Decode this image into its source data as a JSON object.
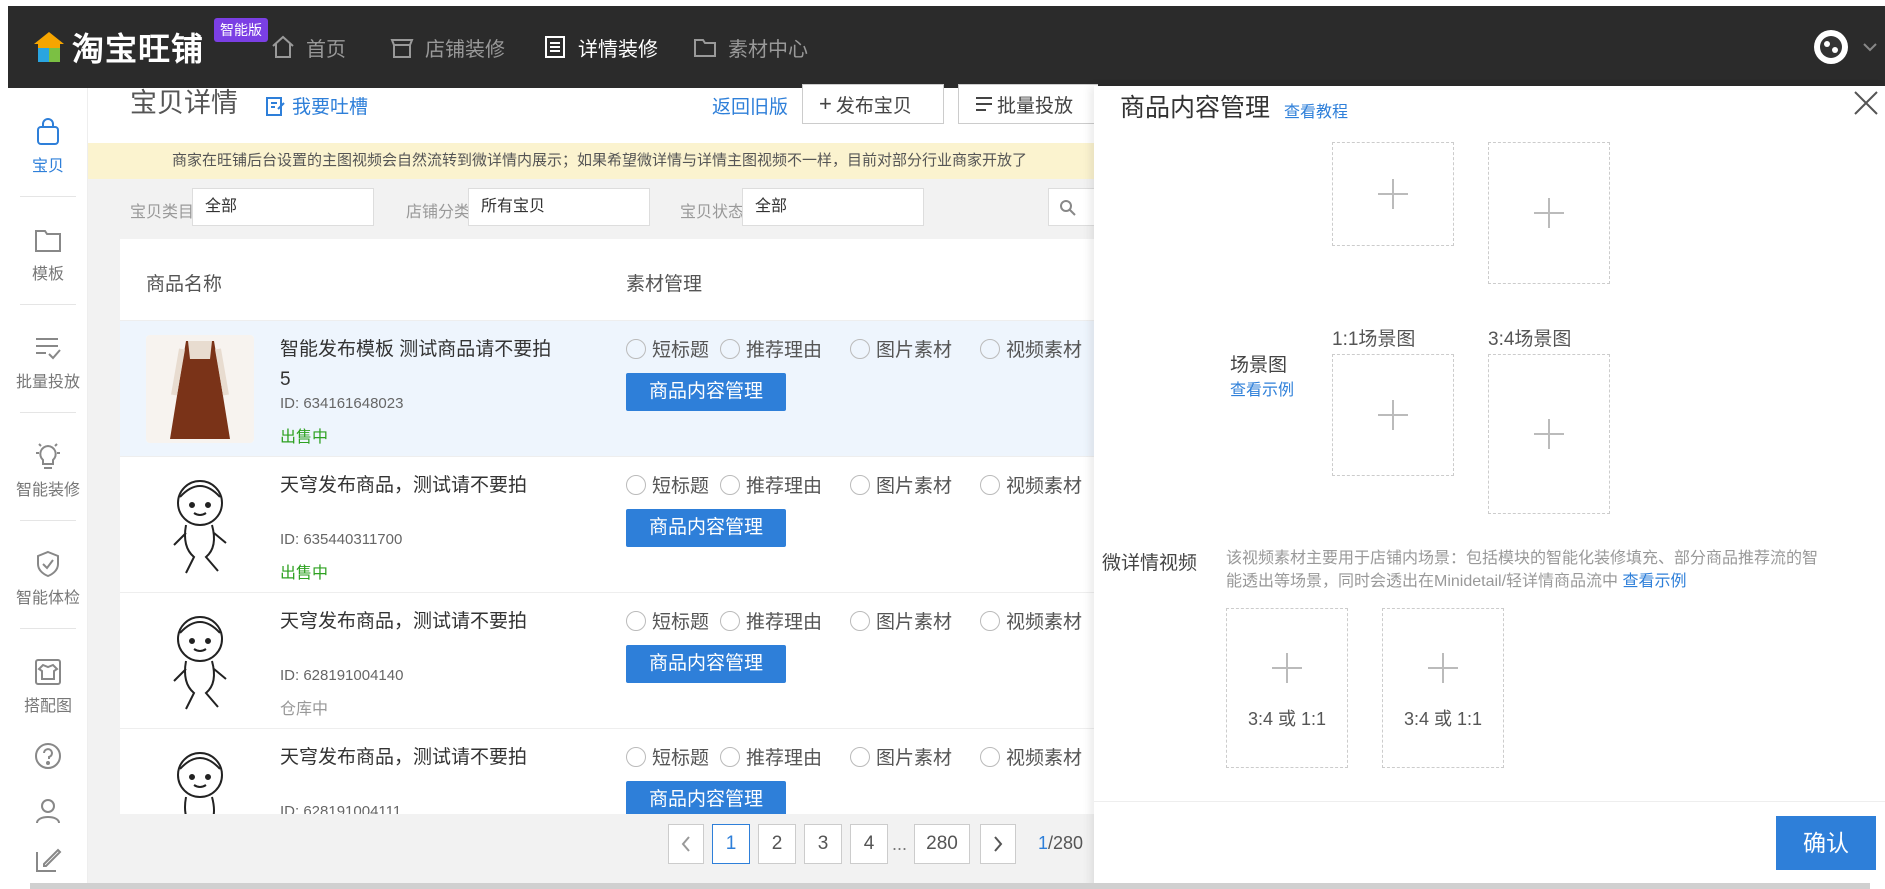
{
  "topbar": {
    "logo_text": "淘宝旺铺",
    "badge": "智能版",
    "nav": [
      {
        "label": "首页",
        "icon": "home-icon"
      },
      {
        "label": "店铺装修",
        "icon": "store-icon"
      },
      {
        "label": "详情装修",
        "icon": "document-icon"
      },
      {
        "label": "素材中心",
        "icon": "folder-icon"
      }
    ]
  },
  "sidebar": {
    "items": [
      {
        "label": "宝贝",
        "icon": "bag-icon"
      },
      {
        "label": "模板",
        "icon": "template-icon"
      },
      {
        "label": "批量投放",
        "icon": "batch-icon"
      },
      {
        "label": "智能装修",
        "icon": "bulb-icon"
      },
      {
        "label": "智能体检",
        "icon": "shield-icon"
      },
      {
        "label": "搭配图",
        "icon": "shirt-icon"
      }
    ]
  },
  "header": {
    "title": "宝贝详情",
    "feedback": "我要吐槽",
    "old_version": "返回旧版",
    "publish": "发布宝贝",
    "batch": "批量投放"
  },
  "notice": "商家在旺铺后台设置的主图视频会自然流转到微详情内展示；如果希望微详情与详情主图视频不一样，目前对部分行业商家开放了",
  "filters": {
    "category_label": "宝贝类目",
    "category_value": "全部",
    "shop_label": "店铺分类",
    "shop_value": "所有宝贝",
    "status_label": "宝贝状态",
    "status_value": "全部"
  },
  "table": {
    "col_name": "商品名称",
    "col_material": "素材管理",
    "radio_labels": [
      "短标题",
      "推荐理由",
      "图片素材",
      "视频素材"
    ],
    "manage_btn": "商品内容管理",
    "rows": [
      {
        "name": "智能发布模板 测试商品请不要拍5",
        "id": "ID: 634161648023",
        "status": "出售中"
      },
      {
        "name": "天穹发布商品，测试请不要拍",
        "id": "ID: 635440311700",
        "status": "出售中"
      },
      {
        "name": "天穹发布商品，测试请不要拍",
        "id": "ID: 628191004140",
        "status": "仓库中"
      },
      {
        "name": "天穹发布商品，测试请不要拍",
        "id": "ID: 628191004111",
        "status": ""
      }
    ]
  },
  "pager": {
    "pages": [
      "1",
      "2",
      "3",
      "4"
    ],
    "ellipsis": "...",
    "last": "280",
    "current": "1",
    "total": "/280"
  },
  "panel": {
    "title": "商品内容管理",
    "tutorial": "查看教程",
    "scene_label": "场景图",
    "scene_example": "查看示例",
    "scene_11": "1:1场景图",
    "scene_34": "3:4场景图",
    "video_label": "微详情视频",
    "video_desc": "该视频素材主要用于店铺内场景：包括模块的智能化装修填充、部分商品推荐流的智能透出等场景，同时会透出在Minidetail/轻详情商品流中",
    "video_example": "查看示例",
    "video_box_1": "3:4 或 1:1",
    "video_box_2": "3:4 或 1:1",
    "confirm": "确认"
  }
}
